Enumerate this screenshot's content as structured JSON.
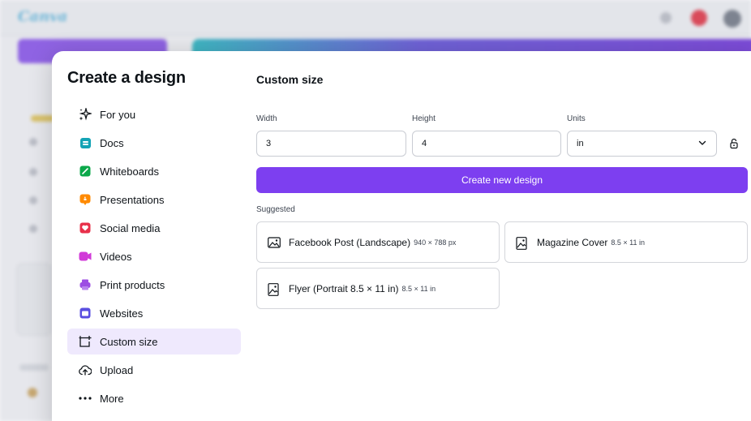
{
  "background": {
    "logo_text": "Canva"
  },
  "modal": {
    "title": "Create a design",
    "nav_items": [
      {
        "label": "For you",
        "icon": "sparkle-icon",
        "color": "#0e1318"
      },
      {
        "label": "Docs",
        "icon": "docs-icon",
        "color": "#13a3b5"
      },
      {
        "label": "Whiteboards",
        "icon": "whiteboard-icon",
        "color": "#0ba84a"
      },
      {
        "label": "Presentations",
        "icon": "presentation-icon",
        "color": "#ff8a00"
      },
      {
        "label": "Social media",
        "icon": "heart-icon",
        "color": "#e8304a"
      },
      {
        "label": "Videos",
        "icon": "video-icon",
        "color": "#d13ad8"
      },
      {
        "label": "Print products",
        "icon": "print-icon",
        "color": "#9c4de3"
      },
      {
        "label": "Websites",
        "icon": "website-icon",
        "color": "#5a4fe0"
      },
      {
        "label": "Custom size",
        "icon": "custom-size-icon",
        "color": "#0e1318",
        "active": true
      },
      {
        "label": "Upload",
        "icon": "upload-icon",
        "color": "#0e1318"
      },
      {
        "label": "More",
        "icon": "more-icon",
        "color": "#0e1318"
      }
    ]
  },
  "custom_size": {
    "title": "Custom size",
    "width_label": "Width",
    "width_value": "3",
    "height_label": "Height",
    "height_value": "4",
    "units_label": "Units",
    "units_value": "in",
    "create_button": "Create new design"
  },
  "suggested": {
    "label": "Suggested",
    "items": [
      {
        "name": "Facebook Post (Landscape)",
        "size": "940 × 788 px",
        "icon": "image-icon"
      },
      {
        "name": "Magazine Cover",
        "size": "8.5 × 11 in",
        "icon": "document-image-icon"
      },
      {
        "name": "Flyer (Portrait 8.5 × 11 in)",
        "size": "8.5 × 11 in",
        "icon": "document-image-icon"
      }
    ]
  },
  "colors": {
    "accent": "#7d3ff0",
    "active_nav_bg": "#efe9fd"
  }
}
